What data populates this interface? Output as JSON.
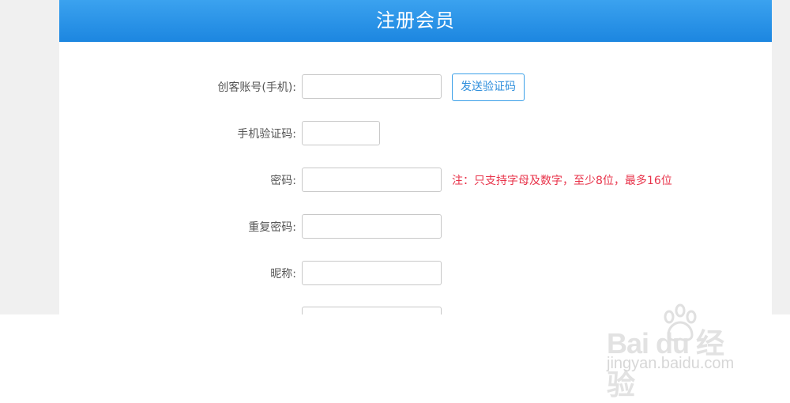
{
  "header": {
    "title": "注册会员"
  },
  "form": {
    "account": {
      "label": "创客账号(手机):",
      "value": "",
      "button": "发送验证码"
    },
    "sms_code": {
      "label": "手机验证码:",
      "value": ""
    },
    "password": {
      "label": "密码:",
      "value": "",
      "note": "注：只支持字母及数字，至少8位，最多16位"
    },
    "confirm_password": {
      "label": "重复密码:",
      "value": ""
    },
    "nickname": {
      "label": "昵称:",
      "value": ""
    },
    "partial_field": {
      "value": ""
    }
  },
  "watermark": {
    "brand": "Bai du 经验",
    "url": "jingyan.baidu.com",
    "icon": "baidu-paw-icon"
  },
  "colors": {
    "header_blue": "#1c86e0",
    "note_red": "#e8334a",
    "button_border": "#3ba0e8",
    "page_bg": "#f0f0f0"
  }
}
